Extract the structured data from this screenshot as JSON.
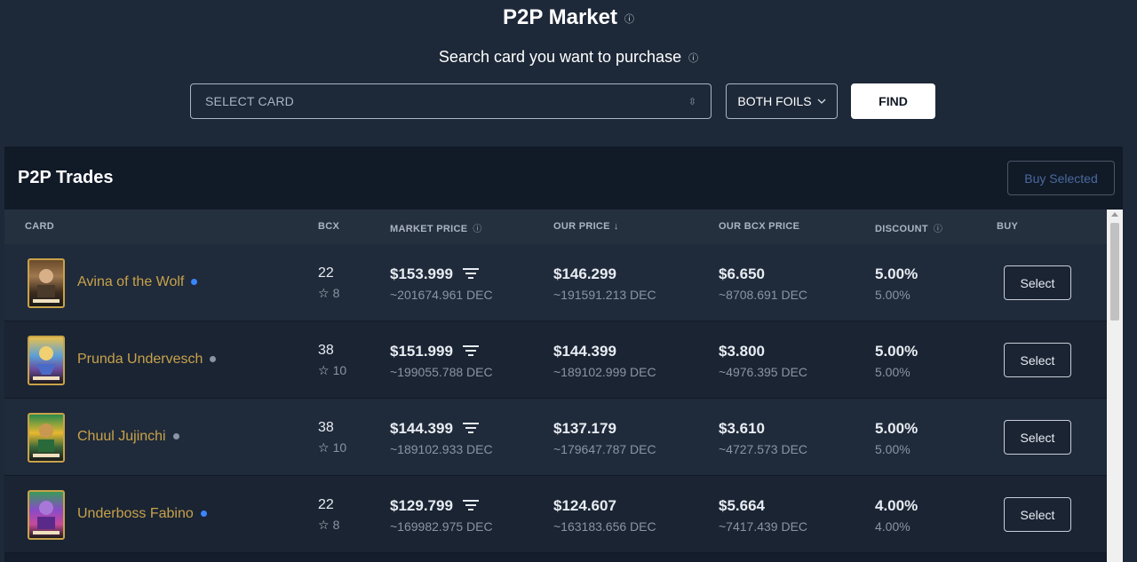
{
  "header": {
    "title": "P2P Market",
    "subtitle": "Search card you want to purchase"
  },
  "search": {
    "select_card_placeholder": "SELECT CARD",
    "foils_value": "BOTH FOILS",
    "find_label": "FIND"
  },
  "panel": {
    "title": "P2P Trades",
    "buy_selected_label": "Buy Selected"
  },
  "columns": {
    "card": "CARD",
    "bcx": "BCX",
    "market_price": "MARKET PRICE",
    "our_price": "OUR PRICE",
    "our_bcx_price": "OUR BCX PRICE",
    "discount": "DISCOUNT",
    "buy": "BUY"
  },
  "rows": [
    {
      "name": "Avina of the Wolf",
      "status_color": "#3a86ff",
      "bcx": "22",
      "level": "8",
      "market_price": "$153.999",
      "market_dec": "~201674.961 DEC",
      "our_price": "$146.299",
      "our_dec": "~191591.213 DEC",
      "bcx_price": "$6.650",
      "bcx_dec": "~8708.691 DEC",
      "discount": "5.00%",
      "discount_sub": "5.00%",
      "select_label": "Select"
    },
    {
      "name": "Prunda Undervesch",
      "status_color": "#8a94a4",
      "bcx": "38",
      "level": "10",
      "market_price": "$151.999",
      "market_dec": "~199055.788 DEC",
      "our_price": "$144.399",
      "our_dec": "~189102.999 DEC",
      "bcx_price": "$3.800",
      "bcx_dec": "~4976.395 DEC",
      "discount": "5.00%",
      "discount_sub": "5.00%",
      "select_label": "Select"
    },
    {
      "name": "Chuul Jujinchi",
      "status_color": "#8a94a4",
      "bcx": "38",
      "level": "10",
      "market_price": "$144.399",
      "market_dec": "~189102.933 DEC",
      "our_price": "$137.179",
      "our_dec": "~179647.787 DEC",
      "bcx_price": "$3.610",
      "bcx_dec": "~4727.573 DEC",
      "discount": "5.00%",
      "discount_sub": "5.00%",
      "select_label": "Select"
    },
    {
      "name": "Underboss Fabino",
      "status_color": "#3a86ff",
      "bcx": "22",
      "level": "8",
      "market_price": "$129.799",
      "market_dec": "~169982.975 DEC",
      "our_price": "$124.607",
      "our_dec": "~163183.656 DEC",
      "bcx_price": "$5.664",
      "bcx_dec": "~7417.439 DEC",
      "discount": "4.00%",
      "discount_sub": "4.00%",
      "select_label": "Select"
    }
  ],
  "icons": {
    "info": "info-icon",
    "sort_desc": "arrow-down-icon",
    "filter": "filter-lines-icon",
    "star": "star-icon",
    "chevron_down": "chevron-down-icon",
    "updown": "updown-chevron-icon"
  }
}
